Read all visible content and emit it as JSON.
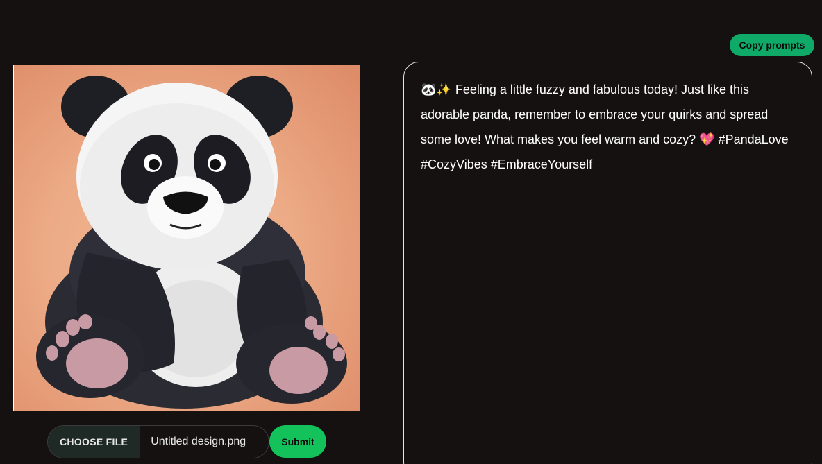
{
  "toolbar": {
    "copy_label": "Copy prompts"
  },
  "image": {
    "alt": "Cartoon panda sitting on an orange background",
    "bg_color_light": "#f2b690",
    "bg_color_dark": "#dd8a66"
  },
  "upload": {
    "choose_label": "CHOOSE FILE",
    "file_name": "Untitled design.png",
    "submit_label": "Submit"
  },
  "output": {
    "text": "🐼✨ Feeling a little fuzzy and fabulous today! Just like this adorable panda, remember to embrace your quirks and spread some love! What makes you feel warm and cozy? 💖 #PandaLove #CozyVibes #EmbraceYourself"
  },
  "colors": {
    "accent_green": "#0fa968",
    "submit_green": "#13c25a",
    "background": "#151111"
  }
}
